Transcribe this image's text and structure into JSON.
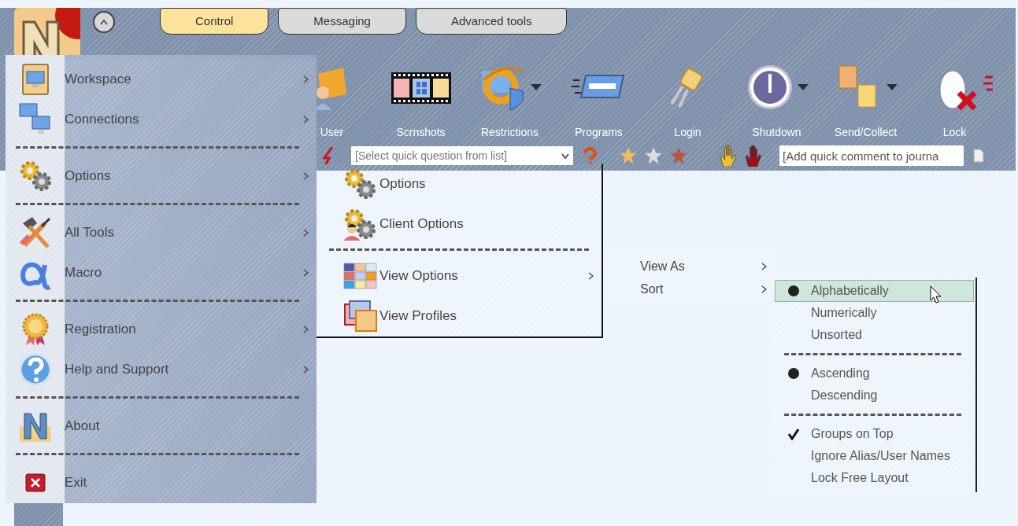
{
  "tabs": [
    {
      "label": "Control",
      "selected": true
    },
    {
      "label": "Messaging",
      "selected": false
    },
    {
      "label": "Advanced tools",
      "selected": false
    }
  ],
  "toolbar": [
    {
      "label": "User",
      "dropdown": false
    },
    {
      "label": "Scrnshots",
      "dropdown": false
    },
    {
      "label": "Restrictions",
      "dropdown": true
    },
    {
      "label": "Programs",
      "dropdown": false
    },
    {
      "label": "Login",
      "dropdown": false
    },
    {
      "label": "Shutdown",
      "dropdown": true
    },
    {
      "label": "Send/Collect",
      "dropdown": true
    },
    {
      "label": "Lock",
      "dropdown": false
    }
  ],
  "quick_question": {
    "placeholder": "[Select quick question from list]"
  },
  "quick_comment": {
    "placeholder": "[Add quick comment to journa"
  },
  "main_menu": [
    {
      "kind": "item",
      "label": "Workspace",
      "submenu": true
    },
    {
      "kind": "item",
      "label": "Connections",
      "submenu": true
    },
    {
      "kind": "separator"
    },
    {
      "kind": "item",
      "label": "Options",
      "submenu": true
    },
    {
      "kind": "separator"
    },
    {
      "kind": "item",
      "label": "All Tools",
      "submenu": true
    },
    {
      "kind": "item",
      "label": "Macro",
      "submenu": true
    },
    {
      "kind": "separator"
    },
    {
      "kind": "item",
      "label": "Registration",
      "submenu": true
    },
    {
      "kind": "item",
      "label": "Help and Support",
      "submenu": true
    },
    {
      "kind": "separator"
    },
    {
      "kind": "item",
      "label": "About",
      "submenu": false
    },
    {
      "kind": "separator"
    },
    {
      "kind": "item",
      "label": "Exit",
      "submenu": false
    }
  ],
  "options_menu": [
    {
      "kind": "item",
      "label": "Options",
      "submenu": false
    },
    {
      "kind": "item",
      "label": "Client Options",
      "submenu": false
    },
    {
      "kind": "separator"
    },
    {
      "kind": "item",
      "label": "View Options",
      "submenu": true
    },
    {
      "kind": "item",
      "label": "View Profiles",
      "submenu": false
    }
  ],
  "view_options_menu": [
    {
      "label": "View As",
      "submenu": true
    },
    {
      "label": "Sort",
      "submenu": true
    }
  ],
  "sort_menu": [
    {
      "kind": "radio",
      "label": "Alphabetically",
      "selected": true,
      "highlighted": true
    },
    {
      "kind": "radio",
      "label": "Numerically",
      "selected": false,
      "highlighted": false
    },
    {
      "kind": "radio",
      "label": "Unsorted",
      "selected": false,
      "highlighted": false
    },
    {
      "kind": "separator"
    },
    {
      "kind": "radio",
      "label": "Ascending",
      "selected": true,
      "highlighted": false
    },
    {
      "kind": "radio",
      "label": "Descending",
      "selected": false,
      "highlighted": false
    },
    {
      "kind": "separator"
    },
    {
      "kind": "check",
      "label": "Groups on Top",
      "checked": true,
      "highlighted": false
    },
    {
      "kind": "check",
      "label": "Ignore Alias/User Names",
      "checked": false,
      "highlighted": false
    },
    {
      "kind": "check",
      "label": "Lock Free Layout",
      "checked": false,
      "highlighted": false
    }
  ]
}
